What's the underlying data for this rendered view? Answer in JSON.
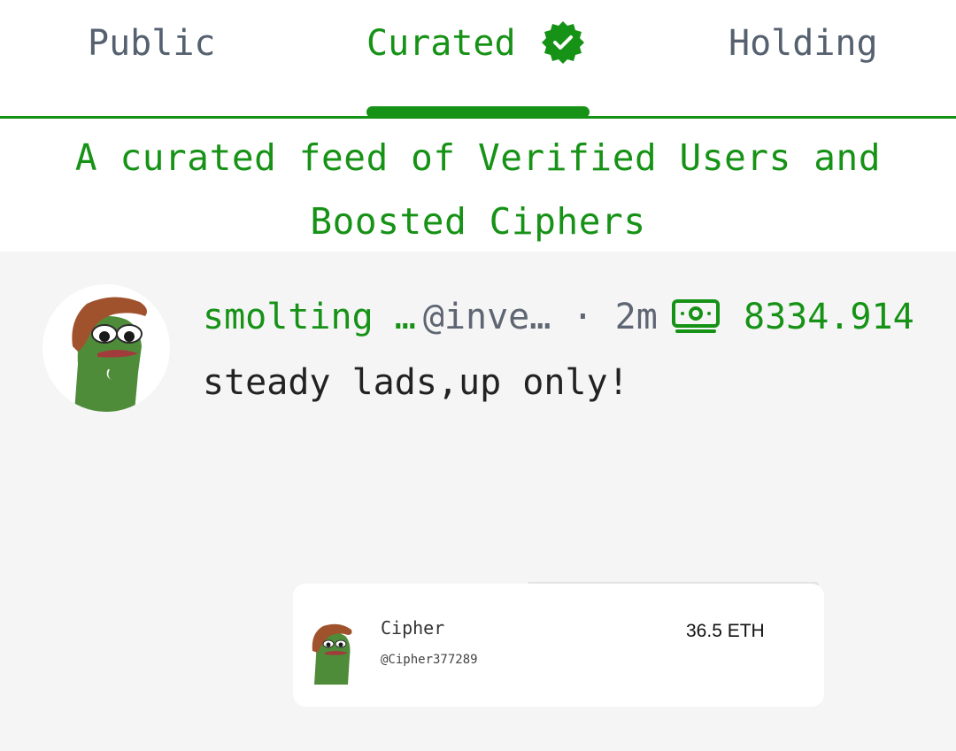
{
  "tabs": {
    "public": "Public",
    "curated": "Curated",
    "holding": "Holding",
    "active": "curated"
  },
  "feed": {
    "description": "A curated feed of Verified Users and Boosted Ciphers"
  },
  "post": {
    "author_name": "smolting …",
    "author_handle": "@inve…",
    "separator": "·",
    "time": "2m",
    "tip_amount": "8334.914",
    "text": "steady lads,up only!"
  },
  "cipher_card": {
    "name": "Cipher",
    "handle": "@Cipher377289",
    "value": "36.5 ETH"
  },
  "colors": {
    "accent": "#169216",
    "tab_inactive": "#566170",
    "background": "#f5f5f5",
    "text": "#222222"
  },
  "icons": {
    "verified": "verified-badge-icon",
    "money": "money-bill-icon"
  }
}
